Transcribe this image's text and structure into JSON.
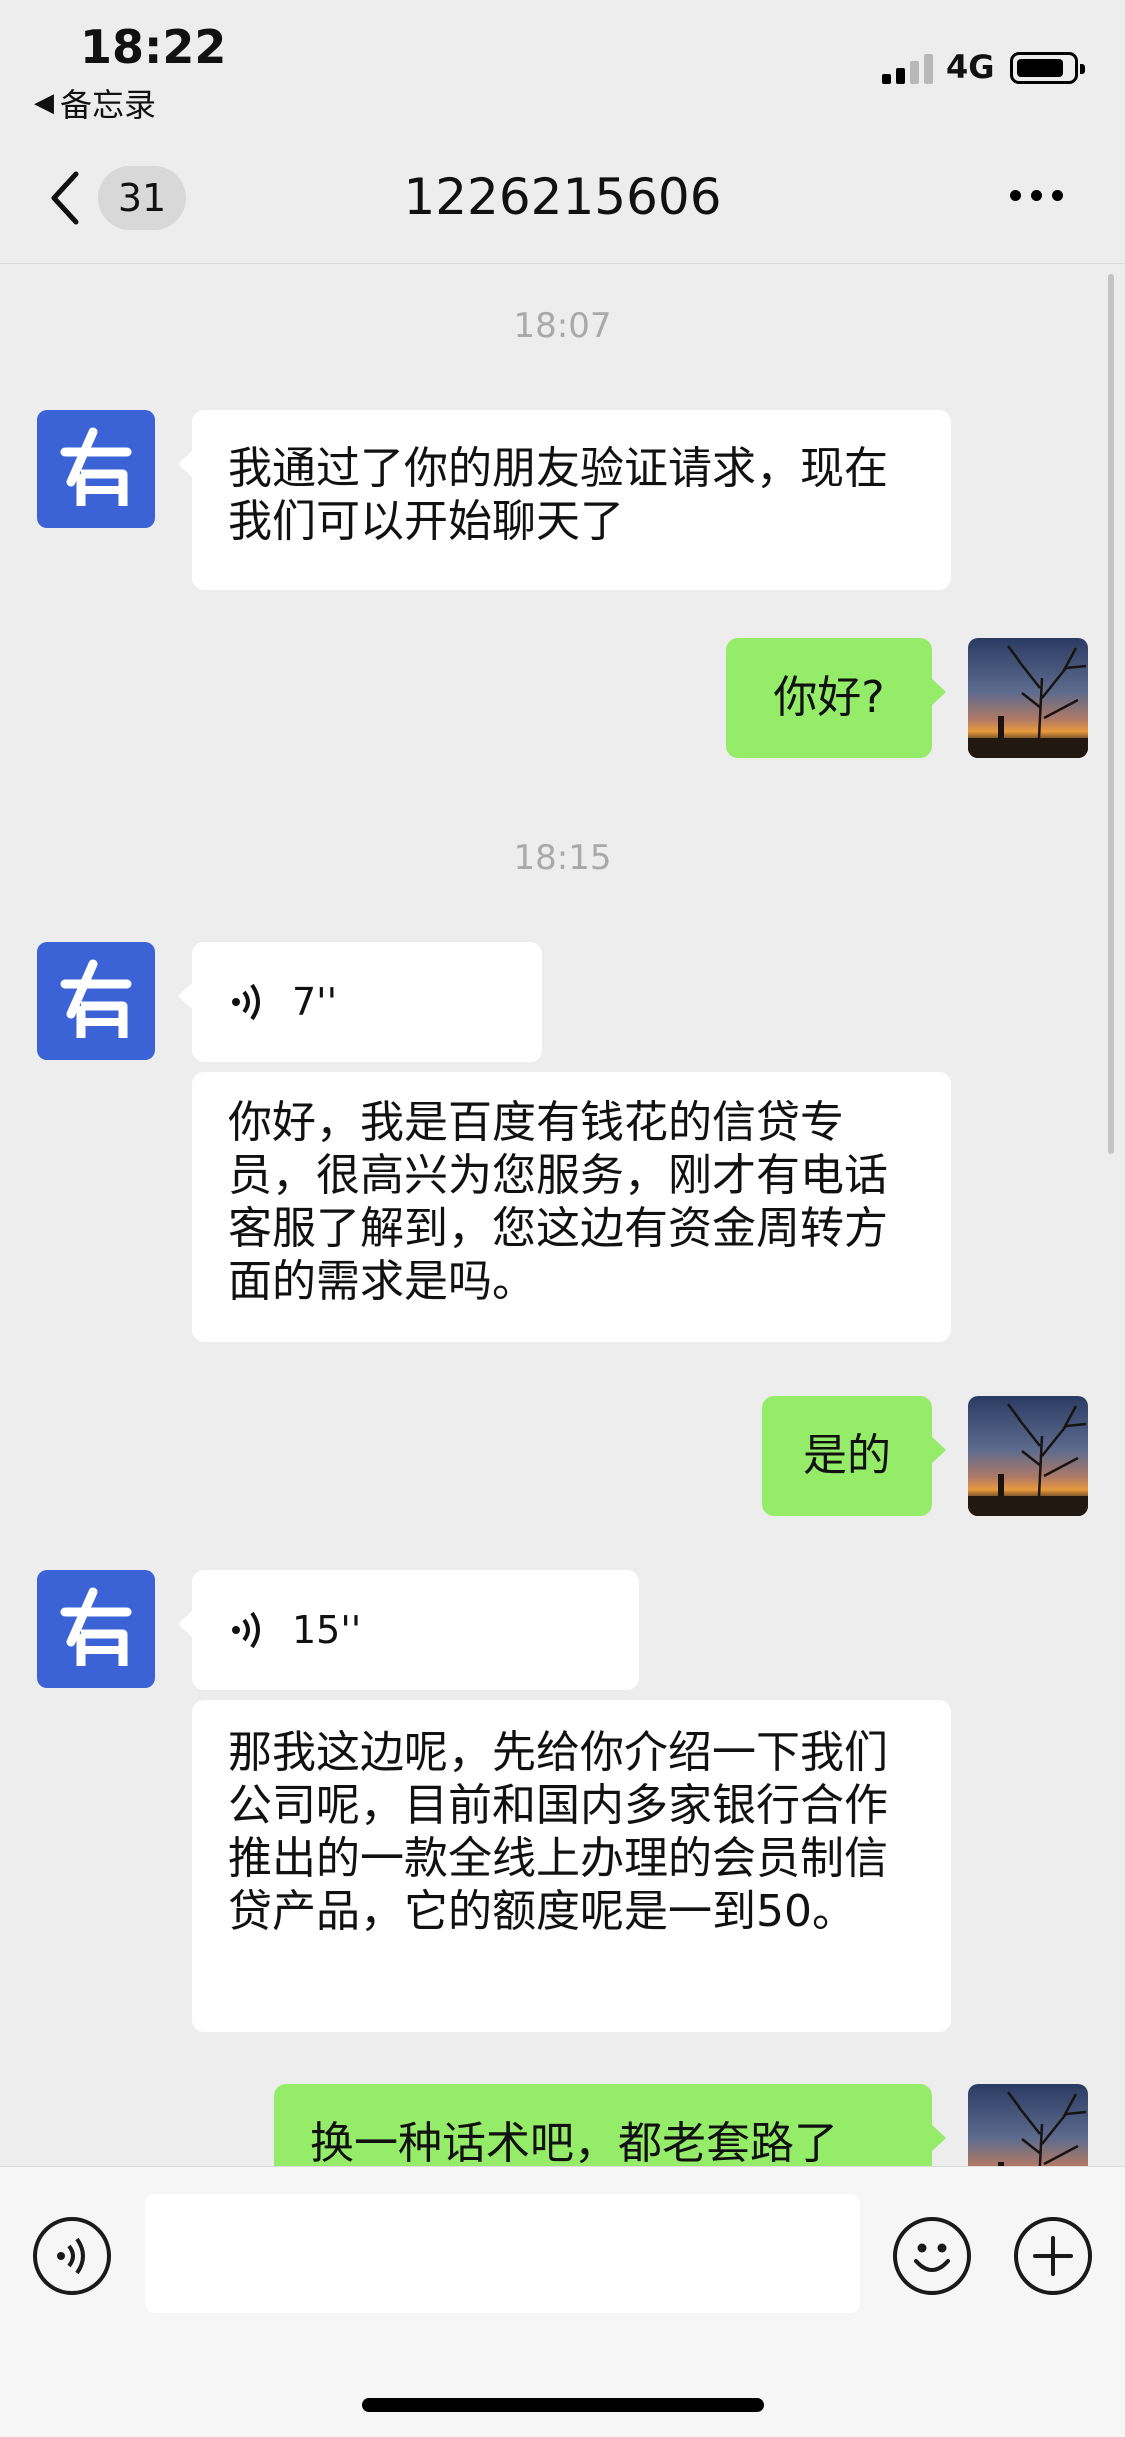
{
  "status_bar": {
    "time": "18:22",
    "back_app": "备忘录",
    "network": "4G"
  },
  "nav": {
    "unread_count": "31",
    "title": "1226215606"
  },
  "chat": {
    "timestamps": [
      "18:07",
      "18:15"
    ],
    "messages": [
      {
        "from": "contact",
        "type": "text",
        "text": "我通过了你的朋友验证请求，现在我们可以开始聊天了"
      },
      {
        "from": "me",
        "type": "text",
        "text": "你好?"
      },
      {
        "from": "contact",
        "type": "voice",
        "duration": "7''"
      },
      {
        "from": "contact",
        "type": "text",
        "text": "你好，我是百度有钱花的信贷专员，很高兴为您服务，刚才有电话客服了解到，您这边有资金周转方面的需求是吗。"
      },
      {
        "from": "me",
        "type": "text",
        "text": "是的"
      },
      {
        "from": "contact",
        "type": "voice",
        "duration": "15''"
      },
      {
        "from": "contact",
        "type": "text",
        "text": "那我这边呢，先给你介绍一下我们公司呢，目前和国内多家银行合作推出的一款全线上办理的会员制信贷产品，它的额度呢是一到50。"
      },
      {
        "from": "me",
        "type": "text",
        "text": "换一种话术吧，都老套路了"
      }
    ]
  },
  "input_bar": {
    "placeholder": ""
  },
  "colors": {
    "background": "#ededed",
    "incoming_bubble": "#ffffff",
    "outgoing_bubble": "#95ec69",
    "contact_avatar": "#3c63d6"
  },
  "icons": {
    "voice_toggle": "voice-icon",
    "emoji": "emoji-icon",
    "add": "plus-icon",
    "back": "chevron-left-icon",
    "more": "more-dots-icon"
  }
}
